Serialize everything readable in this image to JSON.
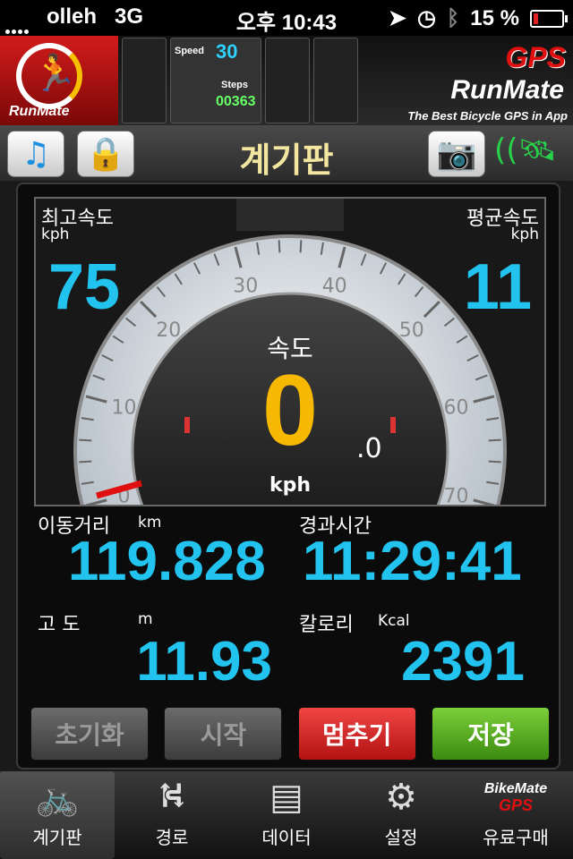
{
  "status": {
    "carrier": "olleh",
    "network": "3G",
    "time": "오후 10:43",
    "battery": "15 %",
    "battery_level": 0.15
  },
  "banner": {
    "logo_text": "RunMate",
    "gps": "GPS",
    "brand": "RunMate",
    "tagline": "The Best Bicycle GPS in App",
    "shot_speed_label": "Speed",
    "shot_speed_value": "30",
    "shot_steps_label": "Steps",
    "shot_steps_value": "00363"
  },
  "header": {
    "title": "계기판",
    "music_icon": "music-note-icon",
    "lock_icon": "lock-icon",
    "camera_icon": "camera-icon",
    "gps_icon": "satellite-icon"
  },
  "gauge": {
    "max_speed_label": "최고속도",
    "max_speed_unit": "kph",
    "max_speed_value": "75",
    "avg_speed_label": "평균속도",
    "avg_speed_unit": "kph",
    "avg_speed_value": "11",
    "speed_label": "속도",
    "speed_value": "0",
    "speed_decimal": ".0",
    "speed_unit": "kph",
    "scale": [
      "0",
      "10",
      "20",
      "30",
      "40",
      "50",
      "60",
      "70"
    ],
    "needle_value": 0
  },
  "stats": {
    "distance_label": "이동거리",
    "distance_unit": "km",
    "distance_value": "119.828",
    "elapsed_label": "경과시간",
    "elapsed_value": "11:29:41",
    "altitude_label": "고 도",
    "altitude_unit": "m",
    "altitude_value": "11.93",
    "calorie_label": "칼로리",
    "calorie_unit": "Kcal",
    "calorie_value": "2391"
  },
  "actions": {
    "reset": "초기화",
    "start": "시작",
    "stop": "멈추기",
    "save": "저장"
  },
  "tabs": [
    {
      "label": "계기판",
      "icon": "bicycle-icon"
    },
    {
      "label": "경로",
      "icon": "road-icon"
    },
    {
      "label": "데이터",
      "icon": "list-icon"
    },
    {
      "label": "설정",
      "icon": "gear-icon"
    },
    {
      "label": "유료구매",
      "icon": "bikemate-icon",
      "brand": "BikeMate",
      "brand_sub": "GPS"
    }
  ],
  "colors": {
    "accent_cyan": "#22c3ee",
    "speed_yellow": "#f6b800",
    "stop_red": "#d42020",
    "save_green": "#5aa823"
  }
}
